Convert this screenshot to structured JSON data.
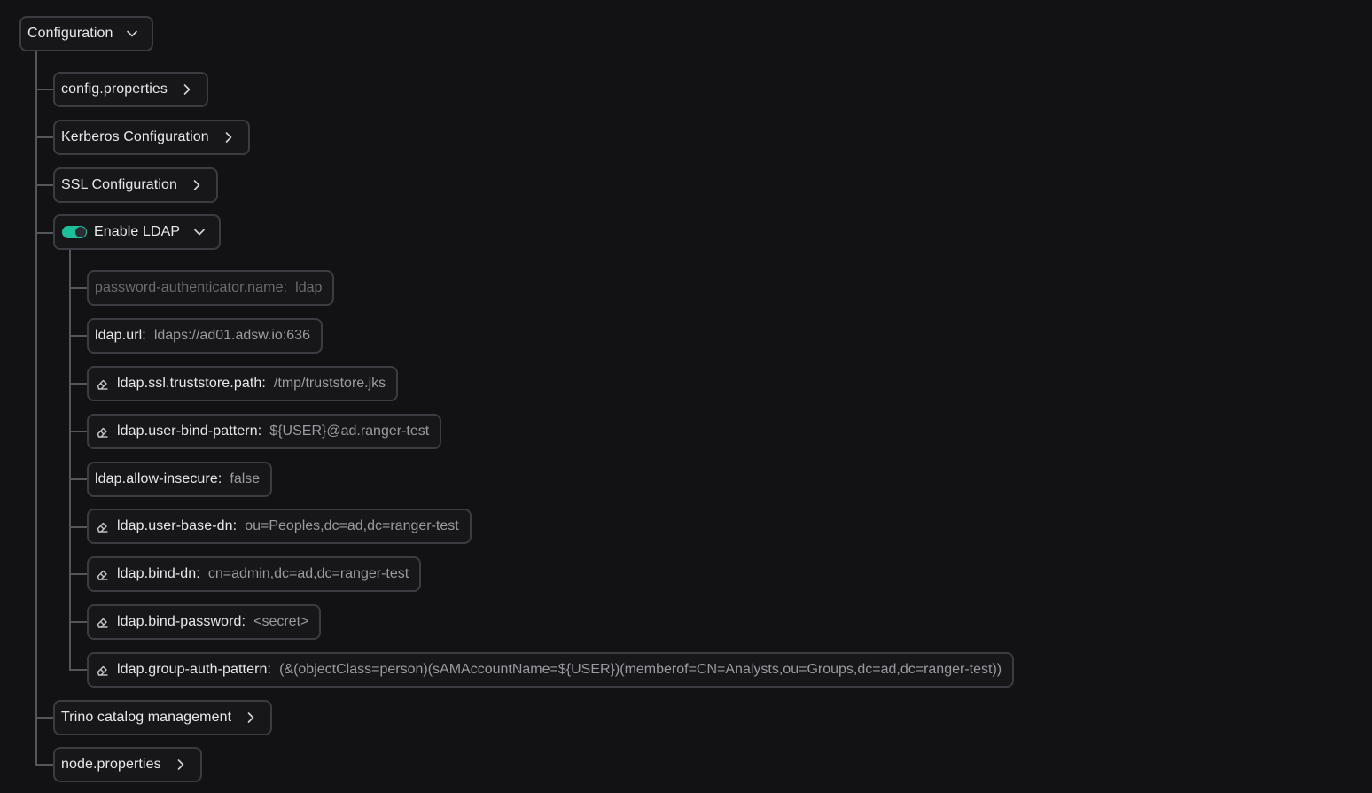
{
  "root": {
    "label": "Configuration",
    "expanded": true
  },
  "items": {
    "config_properties": {
      "label": "config.properties",
      "expanded": false
    },
    "kerberos": {
      "label": "Kerberos Configuration",
      "expanded": false
    },
    "ssl": {
      "label": "SSL Configuration",
      "expanded": false
    },
    "ldap": {
      "label": "Enable LDAP",
      "enabled": true,
      "toggle_color": "#1fbf9a",
      "expanded": true,
      "properties": [
        {
          "key": "password-authenticator.name:",
          "value": "ldap",
          "editable": false,
          "disabled": true
        },
        {
          "key": "ldap.url:",
          "value": "ldaps://ad01.adsw.io:636",
          "editable": false
        },
        {
          "key": "ldap.ssl.truststore.path:",
          "value": "/tmp/truststore.jks",
          "editable": true
        },
        {
          "key": "ldap.user-bind-pattern:",
          "value": "${USER}@ad.ranger-test",
          "editable": true
        },
        {
          "key": "ldap.allow-insecure:",
          "value": "false",
          "editable": false
        },
        {
          "key": "ldap.user-base-dn:",
          "value": "ou=Peoples,dc=ad,dc=ranger-test",
          "editable": true
        },
        {
          "key": "ldap.bind-dn:",
          "value": "cn=admin,dc=ad,dc=ranger-test",
          "editable": true
        },
        {
          "key": "ldap.bind-password:",
          "value": "<secret>",
          "editable": true
        },
        {
          "key": "ldap.group-auth-pattern:",
          "value": "(&(objectClass=person)(sAMAccountName=${USER})(memberof=CN=Analysts,ou=Groups,dc=ad,dc=ranger-test))",
          "editable": true
        }
      ]
    },
    "trino_catalog": {
      "label": "Trino catalog management",
      "expanded": false
    },
    "node_properties": {
      "label": "node.properties",
      "expanded": false
    }
  },
  "icons": {
    "chevron_down": "chevron-down-icon",
    "chevron_right": "chevron-right-icon",
    "eraser": "eraser-icon",
    "toggle": "toggle-switch"
  },
  "colors": {
    "background": "#121214",
    "border": "#3b3c41",
    "tree_line": "#55565c",
    "accent": "#1fbf9a",
    "text": "#e8e8ea",
    "muted": "#9a9ba0"
  }
}
